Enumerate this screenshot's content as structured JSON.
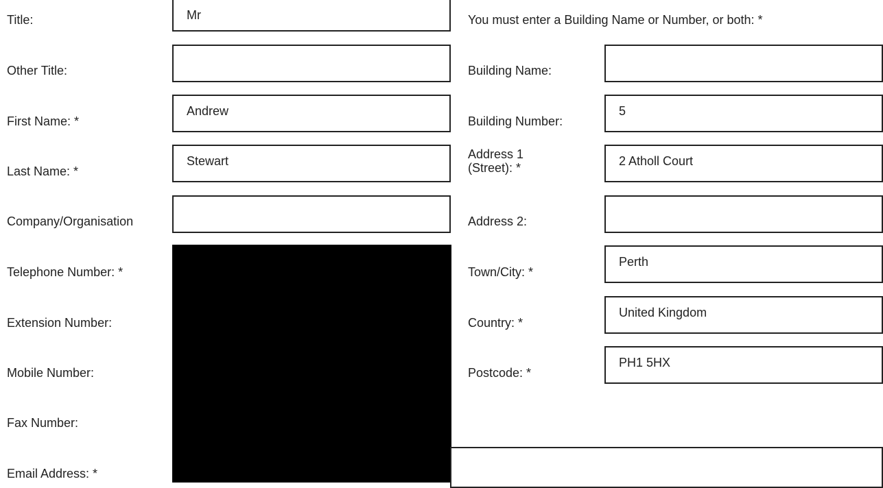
{
  "left": {
    "title": {
      "label": "Title:",
      "value": "Mr"
    },
    "other_title": {
      "label": "Other Title:",
      "value": ""
    },
    "first_name": {
      "label": "First Name: *",
      "value": "Andrew"
    },
    "last_name": {
      "label": "Last Name: *",
      "value": "Stewart"
    },
    "company": {
      "label": "Company/Organisation",
      "value": ""
    },
    "telephone": {
      "label": "Telephone Number: *"
    },
    "extension": {
      "label": "Extension Number:"
    },
    "mobile": {
      "label": "Mobile Number:"
    },
    "fax": {
      "label": "Fax Number:"
    },
    "email": {
      "label": "Email Address: *"
    }
  },
  "right": {
    "notice": "You must enter a Building Name or Number, or both: *",
    "building_name": {
      "label": "Building Name:",
      "value": ""
    },
    "building_number": {
      "label": "Building Number:",
      "value": "5"
    },
    "address1": {
      "label_line1": "Address 1",
      "label_line2": "(Street): *",
      "value": "2 Atholl Court"
    },
    "address2": {
      "label": "Address 2:",
      "value": ""
    },
    "town": {
      "label": "Town/City: *",
      "value": "Perth"
    },
    "country": {
      "label": "Country: *",
      "value": "United Kingdom"
    },
    "postcode": {
      "label": "Postcode: *",
      "value": "PH1 5HX"
    }
  },
  "colors": {
    "text": "#222222",
    "border": "#222222",
    "redaction": "#000000"
  }
}
